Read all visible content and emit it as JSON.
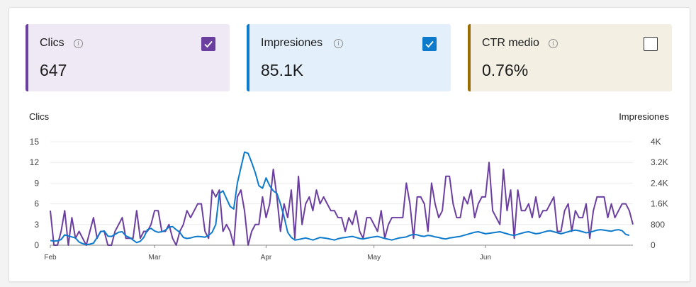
{
  "cards": [
    {
      "title": "Clics",
      "value": "647",
      "checked": true,
      "color": "#6b3fa0",
      "bg": "#efe9f5"
    },
    {
      "title": "Impresiones",
      "value": "85.1K",
      "checked": true,
      "color": "#0d7acc",
      "bg": "#e3f0fb"
    },
    {
      "title": "CTR medio",
      "value": "0.76%",
      "checked": false,
      "color": "#9a6b00",
      "bg": "#f3efe3"
    }
  ],
  "info_glyph": "i",
  "chart_data": {
    "type": "line",
    "ylabel": "Clics",
    "y2label": "Impresiones",
    "ylim": [
      0,
      15
    ],
    "y2lim": [
      0,
      4000
    ],
    "yticks": [
      "0",
      "3",
      "6",
      "9",
      "12",
      "15"
    ],
    "y2ticks": [
      "0",
      "800",
      "1.6K",
      "2.4K",
      "3.2K",
      "4K"
    ],
    "xticks": [
      "Feb",
      "Mar",
      "Apr",
      "May",
      "Jun"
    ],
    "xtick_days": [
      0,
      29,
      60,
      90,
      121
    ],
    "grid": true,
    "series": [
      {
        "name": "Clics",
        "axis": "left",
        "color": "#6b3fa0",
        "values": [
          5,
          0,
          0,
          2,
          5,
          0,
          4,
          1,
          2,
          1,
          0,
          2,
          4,
          1,
          2,
          2,
          0,
          0,
          2,
          3,
          4,
          1,
          1,
          1,
          5,
          1,
          2,
          2,
          3,
          5,
          5,
          2,
          2,
          3,
          1,
          0,
          2,
          3,
          5,
          4,
          5,
          6,
          6,
          2,
          1,
          8,
          7,
          8,
          2,
          3,
          2,
          0,
          7,
          8,
          5,
          0,
          2,
          3,
          3,
          7,
          4,
          6,
          11,
          7,
          2,
          6,
          4,
          8,
          1,
          10,
          3,
          6,
          7,
          5,
          8,
          6,
          7,
          6,
          5,
          5,
          4,
          4,
          2,
          4,
          3,
          5,
          2,
          1,
          4,
          4,
          3,
          2,
          5,
          1,
          3,
          4,
          4,
          4,
          4,
          9,
          6,
          1,
          7,
          7,
          6,
          2,
          9,
          6,
          4,
          5,
          10,
          10,
          6,
          4,
          4,
          7,
          6,
          8,
          4,
          6,
          7,
          7,
          12,
          5,
          4,
          3,
          11,
          5,
          8,
          1,
          8,
          5,
          5,
          6,
          4,
          7,
          4,
          5,
          5,
          6,
          7,
          2,
          2,
          5,
          6,
          2,
          5,
          4,
          4,
          6,
          1,
          5,
          7,
          7,
          7,
          4,
          6,
          4,
          5,
          6,
          6,
          5,
          3
        ],
        "marked": [
          [
            0,
            5
          ],
          [
            1,
            0
          ],
          [
            2,
            0
          ],
          [
            5,
            0
          ],
          [
            6,
            4
          ],
          [
            11,
            2
          ],
          [
            17,
            1
          ],
          [
            21,
            0
          ],
          [
            24,
            5
          ],
          [
            27,
            2
          ],
          [
            30,
            5
          ],
          [
            34,
            1
          ],
          [
            35,
            0
          ],
          [
            40,
            4
          ],
          [
            43,
            2
          ],
          [
            47,
            7
          ],
          [
            51,
            0
          ],
          [
            54,
            5
          ],
          [
            58,
            3
          ],
          [
            62,
            11
          ],
          [
            64,
            2
          ],
          [
            70,
            3
          ],
          [
            74,
            6
          ],
          [
            79,
            5
          ],
          [
            84,
            3
          ],
          [
            89,
            4
          ],
          [
            94,
            3
          ],
          [
            99,
            9
          ],
          [
            103,
            7
          ],
          [
            108,
            5
          ],
          [
            113,
            4
          ],
          [
            118,
            6
          ],
          [
            122,
            12
          ],
          [
            125,
            3
          ],
          [
            128,
            8
          ],
          [
            133,
            6
          ],
          [
            138,
            5
          ],
          [
            142,
            2
          ],
          [
            146,
            2
          ],
          [
            150,
            1
          ],
          [
            154,
            7
          ],
          [
            158,
            6
          ]
        ]
      },
      {
        "name": "Impresiones",
        "axis": "right",
        "color": "#0d7acc",
        "values": [
          180,
          160,
          170,
          220,
          400,
          360,
          320,
          280,
          120,
          60,
          20,
          40,
          80,
          300,
          520,
          550,
          350,
          340,
          420,
          500,
          520,
          360,
          300,
          200,
          100,
          150,
          300,
          600,
          650,
          550,
          500,
          520,
          580,
          700,
          720,
          600,
          500,
          300,
          260,
          280,
          320,
          340,
          330,
          310,
          380,
          500,
          800,
          2000,
          2100,
          1800,
          1500,
          1400,
          2400,
          3000,
          3600,
          3550,
          3200,
          2800,
          2300,
          2200,
          2600,
          2300,
          2100,
          2000,
          1600,
          1100,
          500,
          300,
          200,
          220,
          250,
          280,
          240,
          200,
          250,
          300,
          280,
          260,
          230,
          200,
          250,
          280,
          300,
          320,
          340,
          300,
          260,
          240,
          270,
          300,
          320,
          340,
          300,
          260,
          230,
          200,
          240,
          280,
          300,
          320,
          380,
          420,
          400,
          360,
          340,
          380,
          360,
          320,
          300,
          260,
          240,
          280,
          300,
          320,
          340,
          380,
          420,
          460,
          500,
          520,
          480,
          440,
          460,
          480,
          500,
          520,
          480,
          440,
          400,
          380,
          420,
          460,
          500,
          520,
          480,
          440,
          460,
          500,
          540,
          560,
          520,
          480,
          440,
          480,
          520,
          560,
          580,
          560,
          520,
          480,
          500,
          540,
          580,
          600,
          580,
          560,
          540,
          580,
          600,
          560,
          420,
          380
        ]
      }
    ]
  }
}
